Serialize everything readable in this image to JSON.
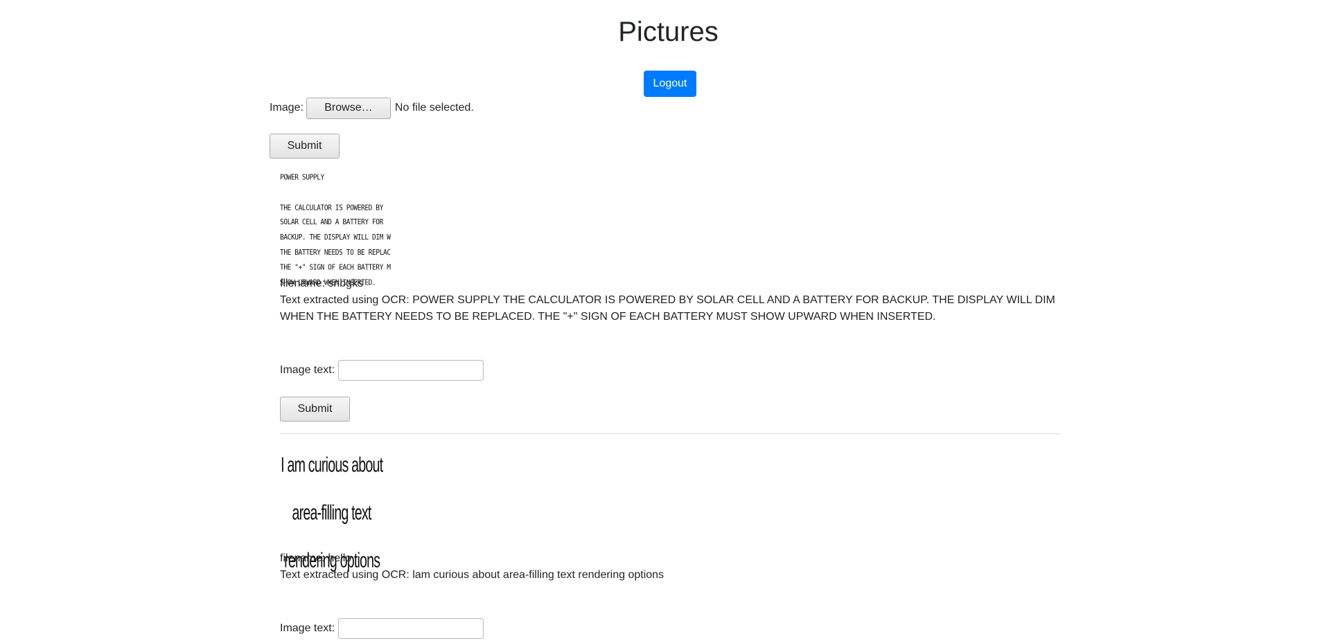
{
  "page": {
    "title": "Pictures",
    "logout_label": "Logout"
  },
  "upload": {
    "image_label": "Image:",
    "browse_label": "Browse…",
    "no_file_text": "No file selected.",
    "submit_label": "Submit"
  },
  "entries": [
    {
      "image_lines": [
        "POWER SUPPLY",
        "",
        "THE CALCULATOR IS POWERED BY",
        "SOLAR CELL AND A BATTERY FOR",
        "BACKUP. THE DISPLAY WILL DIM WHEN",
        "THE BATTERY NEEDS TO BE REPLACED.",
        "THE \"+\" SIGN OF EACH BATTERY MUST",
        "SHOW UPWARD WHEN INSERTED."
      ],
      "filename_text": "filename: snbgks",
      "ocr_text": "Text extracted using OCR: POWER SUPPLY THE CALCULATOR IS POWERED BY SOLAR CELL AND A BATTERY FOR BACKUP. THE DISPLAY WILL DIM WHEN THE BATTERY NEEDS TO BE REPLACED. THE \"+\" SIGN OF EACH BATTERY MUST SHOW UPWARD WHEN INSERTED.",
      "image_text_label": "Image text:",
      "image_text_value": "",
      "submit_label": "Submit"
    },
    {
      "image_lines": [
        "I am curious about",
        "area-filling text",
        "rendering options"
      ],
      "filename_text": "filename: hello",
      "ocr_text": "Text extracted using OCR: lam curious about area-filling text rendering options",
      "image_text_label": "Image text:",
      "image_text_value": ""
    }
  ]
}
